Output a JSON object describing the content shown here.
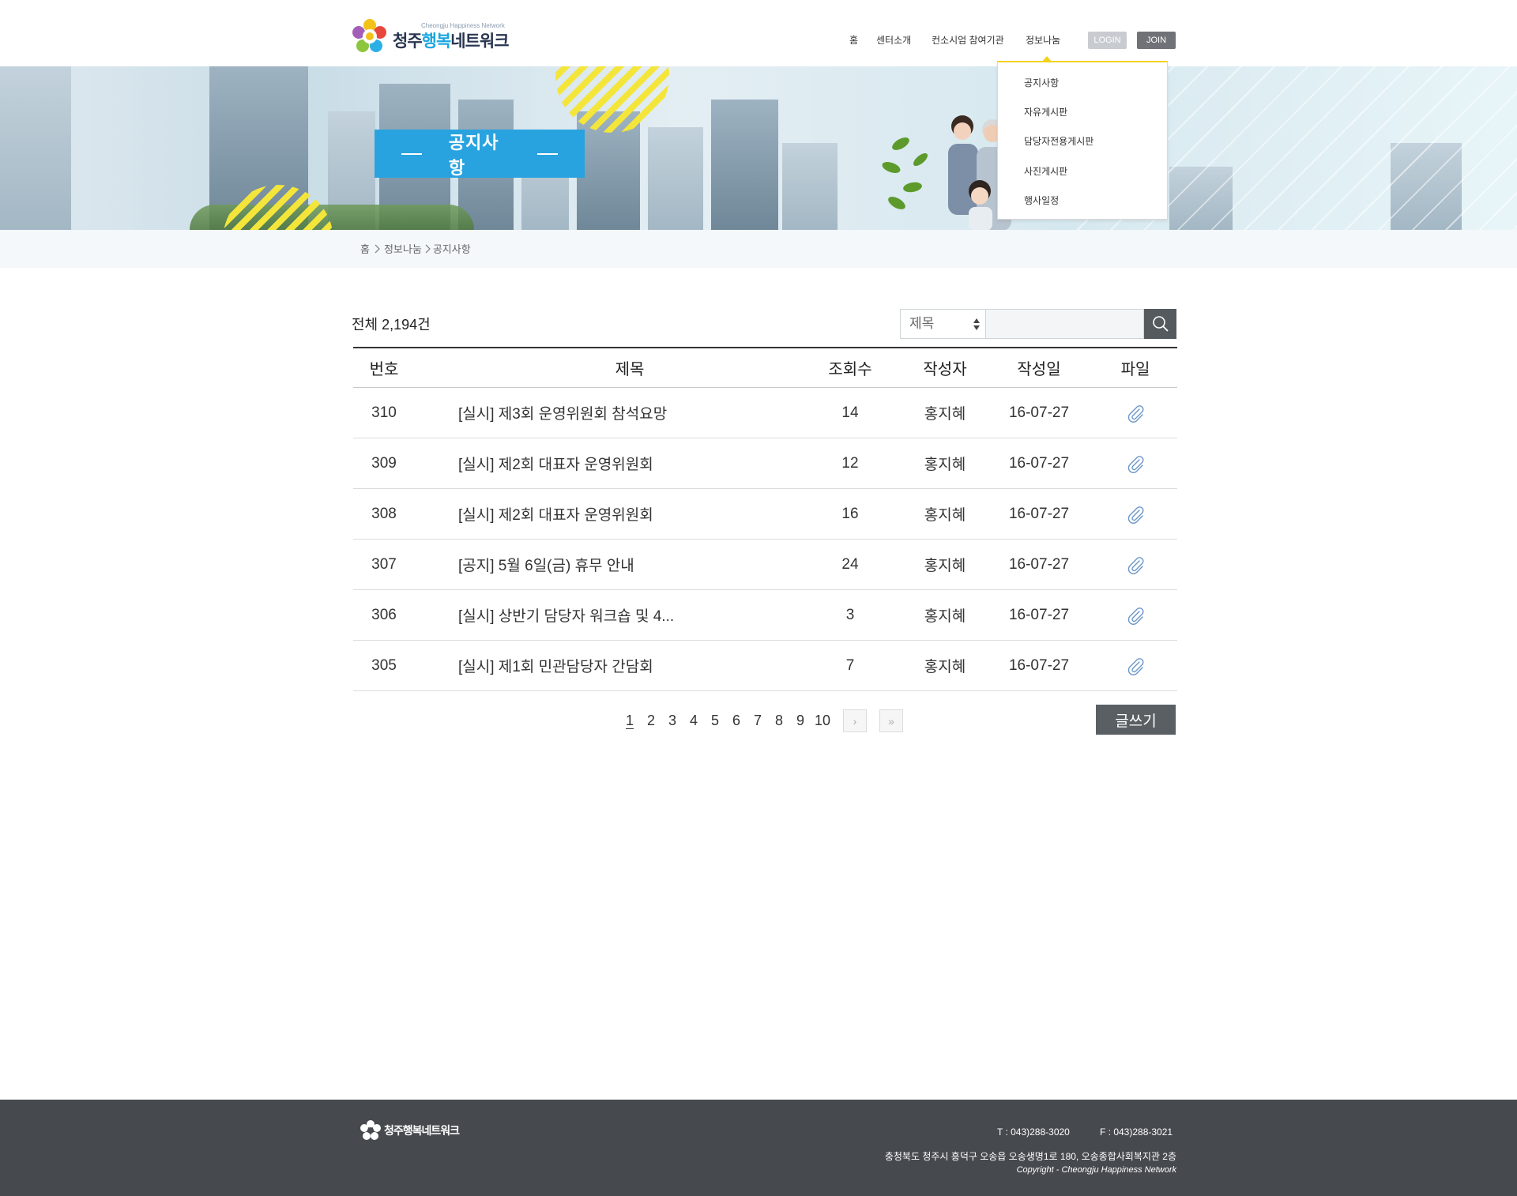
{
  "brand": {
    "name_small": "Cheongju Happiness Network",
    "name_part1": "청주",
    "name_part2": "행복",
    "name_part3": "네트워크"
  },
  "nav": {
    "items": [
      "홈",
      "센터소개",
      "컨소시엄 참여기관",
      "정보나눔"
    ],
    "login": "LOGIN",
    "join": "JOIN"
  },
  "dropdown": {
    "items": [
      "공지사항",
      "자유게시판",
      "담당자전용게시판",
      "사진게시판",
      "행사일정"
    ]
  },
  "banner": {
    "title": "공지사항"
  },
  "breadcrumb": {
    "home": "홈",
    "level1": "정보나눔",
    "level2": "공지사항"
  },
  "list": {
    "total": "전체 2,194건",
    "search_select": "제목",
    "search_value": "",
    "columns": [
      "번호",
      "제목",
      "조회수",
      "작성자",
      "작성일",
      "파일"
    ],
    "rows": [
      {
        "num": "310",
        "title": "[실시] 제3회 운영위원회 참석요망",
        "views": "14",
        "writer": "홍지혜",
        "date": "16-07-27"
      },
      {
        "num": "309",
        "title": "[실시] 제2회 대표자 운영위원회",
        "views": "12",
        "writer": "홍지혜",
        "date": "16-07-27"
      },
      {
        "num": "308",
        "title": "[실시] 제2회 대표자 운영위원회",
        "views": "16",
        "writer": "홍지혜",
        "date": "16-07-27"
      },
      {
        "num": "307",
        "title": "[공지] 5월 6일(금) 휴무 안내",
        "views": "24",
        "writer": "홍지혜",
        "date": "16-07-27"
      },
      {
        "num": "306",
        "title": "[실시] 상반기 담당자 워크숍 및 4...",
        "views": "3",
        "writer": "홍지혜",
        "date": "16-07-27"
      },
      {
        "num": "305",
        "title": "[실시] 제1회 민관담당자 간담회",
        "views": "7",
        "writer": "홍지혜",
        "date": "16-07-27"
      }
    ]
  },
  "pagination": {
    "pages": [
      "1",
      "2",
      "3",
      "4",
      "5",
      "6",
      "7",
      "8",
      "9",
      "10"
    ],
    "current": "1",
    "next": "›",
    "last": "»"
  },
  "write_button": "글쓰기",
  "footer": {
    "tel": "T : 043)288-3020",
    "fax": "F : 043)288-3021",
    "address": "충청북도 청주시 흥덕구 오송읍 오송생명1로 180, 오송종합사회복지관 2층",
    "copyright": "Copyright - Cheongju Happiness Network",
    "logo_text": "청주행복네트워크"
  },
  "colors": {
    "accent": "#28a3e0",
    "dropdown_border": "#f1d21c",
    "footer_bg": "#464a4f",
    "button_dark": "#5a5f64"
  }
}
